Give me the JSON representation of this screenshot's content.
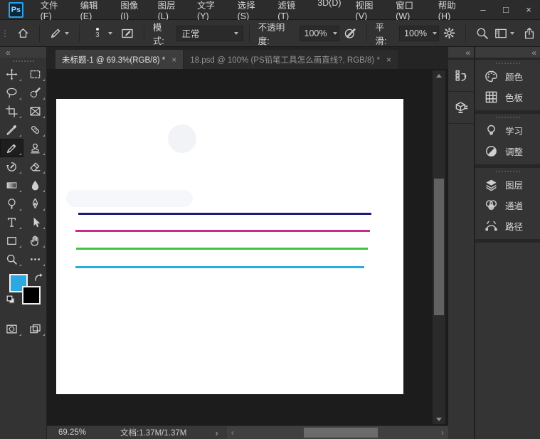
{
  "window": {
    "logo": "Ps",
    "controls": {
      "minimize": "–",
      "maximize": "□",
      "close": "×"
    }
  },
  "menu_bar": {
    "items": [
      "文件(F)",
      "编辑(E)",
      "图像(I)",
      "图层(L)",
      "文字(Y)",
      "选择(S)",
      "滤镜(T)",
      "3D(D)",
      "视图(V)",
      "窗口(W)",
      "帮助(H)"
    ]
  },
  "options_bar": {
    "icons": [
      "home",
      "pencil-tool-preset",
      "brush-size-preview",
      "brush-settings-panel-toggle",
      "opacity-pressure",
      "smoothing-gear",
      "search",
      "workspace-switcher",
      "share"
    ],
    "brush_size": "3",
    "mode_label": "模式:",
    "mode_value": "正常",
    "opacity_label": "不透明度:",
    "opacity_value": "100%",
    "smoothing_label": "平滑:",
    "smoothing_value": "100%"
  },
  "tab_bar": {
    "tabs": [
      {
        "label": "未标题-1 @ 69.3%(RGB/8) *",
        "close": "×",
        "active": true
      },
      {
        "label": "18.psd @ 100% (PS铅笔工具怎么画直线?, RGB/8) *",
        "close": "×",
        "active": false
      }
    ]
  },
  "toolbar": {
    "collapse_chevron": "«",
    "tools": [
      "move",
      "rectangular-marquee",
      "lasso",
      "quick-selection",
      "crop",
      "frame",
      "eyedropper",
      "spot-healing-brush",
      "pencil",
      "clone-stamp",
      "history-brush",
      "eraser",
      "gradient",
      "blur",
      "dodge",
      "pen",
      "type",
      "path-selection",
      "rectangle",
      "hand",
      "zoom",
      "edit-toolbar-ellipsis"
    ],
    "selected_tool": "pencil",
    "foreground_color": "#2DA9E1",
    "background_color": "#000000",
    "bottom_tools": [
      "quick-mask-mode",
      "screen-mode"
    ]
  },
  "panels": {
    "collapse_chevron": "«",
    "icon_strip": [
      "history",
      "libraries"
    ],
    "buttons": [
      {
        "icon": "color-palette",
        "label": "颜色"
      },
      {
        "icon": "swatches-grid",
        "label": "色板"
      },
      {
        "icon": "learn-bulb",
        "label": "学习"
      },
      {
        "icon": "adjustments-circle",
        "label": "调整"
      },
      {
        "icon": "layers-stack",
        "label": "图层"
      },
      {
        "icon": "channels-circles",
        "label": "通道"
      },
      {
        "icon": "paths-anchor",
        "label": "路径"
      }
    ]
  },
  "canvas": {
    "lines": [
      {
        "color": "#1E1B7B"
      },
      {
        "color": "#C92C86"
      },
      {
        "color": "#3FC43F"
      },
      {
        "color": "#29ABE2"
      }
    ]
  },
  "status_bar": {
    "zoom_level": "69.25%",
    "doc_info": "文档:1.37M/1.37M",
    "expand_chevron": "›",
    "scroll_left": "‹",
    "scroll_right": "›"
  }
}
